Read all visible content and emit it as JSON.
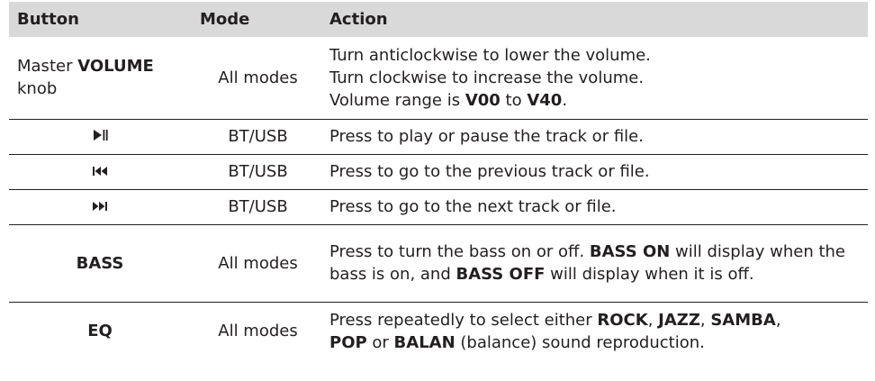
{
  "headers": {
    "button": "Button",
    "mode": "Mode",
    "action": "Action"
  },
  "rows": [
    {
      "button": {
        "prefix": "Master ",
        "bold": "VOLUME",
        "suffix": "knob"
      },
      "mode": "All modes",
      "action_lines": [
        "Turn anticlockwise to lower the volume.",
        "Turn clockwise to increase the volume."
      ],
      "range": {
        "prefix": "Volume range is ",
        "min": "V00",
        "mid": " to ",
        "max": "V40",
        "end": "."
      }
    },
    {
      "button_icon": "play-pause-icon",
      "mode": "BT/USB",
      "action": "Press to play or pause the track or file."
    },
    {
      "button_icon": "previous-track-icon",
      "mode": "BT/USB",
      "action": "Press to go to the previous track or file."
    },
    {
      "button_icon": "next-track-icon",
      "mode": "BT/USB",
      "action": "Press to go to the next track or file."
    },
    {
      "button": "BASS",
      "mode": "All modes",
      "action": {
        "t1": "Press to turn the bass on or off. ",
        "b1": "BASS ON",
        "t2": " will display when the bass is on, and ",
        "b2": "BASS OFF",
        "t3": " will display when it is off."
      }
    },
    {
      "button": "EQ",
      "mode": "All modes",
      "action": {
        "t1": "Press repeatedly to select either ",
        "b1": "ROCK",
        "t2": ", ",
        "b2": "JAZZ",
        "t3": ", ",
        "b3": "SAMBA",
        "t4": ", ",
        "b4": "POP",
        "t5": " or ",
        "b5": "BALAN",
        "t6": " (balance) sound reproduction."
      }
    }
  ]
}
